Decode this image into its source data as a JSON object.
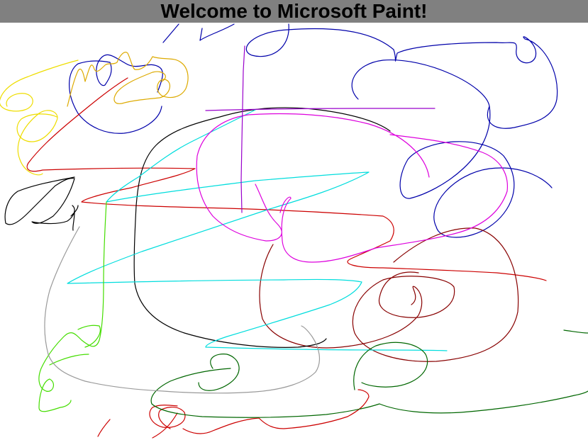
{
  "header": {
    "title": "Welcome to Microsoft Paint!"
  },
  "colors": {
    "header_bg": "#808080",
    "canvas_bg": "#ffffff",
    "blue": "#0000aa",
    "gold": "#ddaa00",
    "yellow": "#eedd00",
    "red": "#cc0000",
    "dark_red": "#880000",
    "black": "#000000",
    "cyan": "#00dddd",
    "magenta": "#dd00dd",
    "purple": "#9900cc",
    "green": "#44dd00",
    "dark_green": "#006600",
    "gray": "#999999"
  }
}
